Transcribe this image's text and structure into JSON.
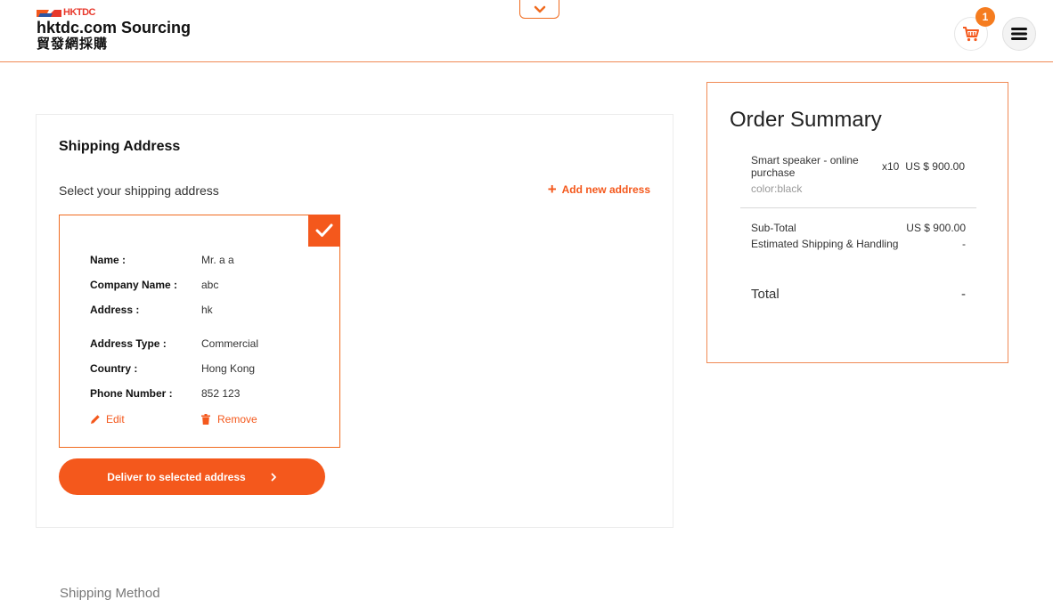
{
  "header": {
    "logo_abbrev": "HKTDC",
    "site_name": "hktdc.com Sourcing",
    "site_name_cn": "貿發網採購",
    "cart_count": "1"
  },
  "shipping": {
    "title": "Shipping Address",
    "select_label": "Select your shipping address",
    "add_new_label": "Add new address",
    "address": {
      "name_label": "Name :",
      "name_value": "Mr. a a",
      "company_label": "Company Name :",
      "company_value": "abc",
      "address_label": "Address :",
      "address_value": "hk",
      "type_label": "Address Type :",
      "type_value": "Commercial",
      "country_label": "Country :",
      "country_value": "Hong Kong",
      "phone_label": "Phone Number :",
      "phone_value": "852 123",
      "edit_label": "Edit",
      "remove_label": "Remove"
    },
    "deliver_label": "Deliver to selected address"
  },
  "summary": {
    "title": "Order Summary",
    "item_name": "Smart speaker - online purchase",
    "item_qty": "x10",
    "item_price": "US $ 900.00",
    "item_color": "color:black",
    "subtotal_label": "Sub-Total",
    "subtotal_value": "US $ 900.00",
    "shipping_label": "Estimated Shipping & Handling",
    "shipping_value": "-",
    "total_label": "Total",
    "total_value": "-"
  },
  "shipping_method": {
    "label": "Shipping Method"
  },
  "colors": {
    "accent": "#f4581c",
    "border_accent": "#f06b1f",
    "badge": "#f57c1f"
  }
}
